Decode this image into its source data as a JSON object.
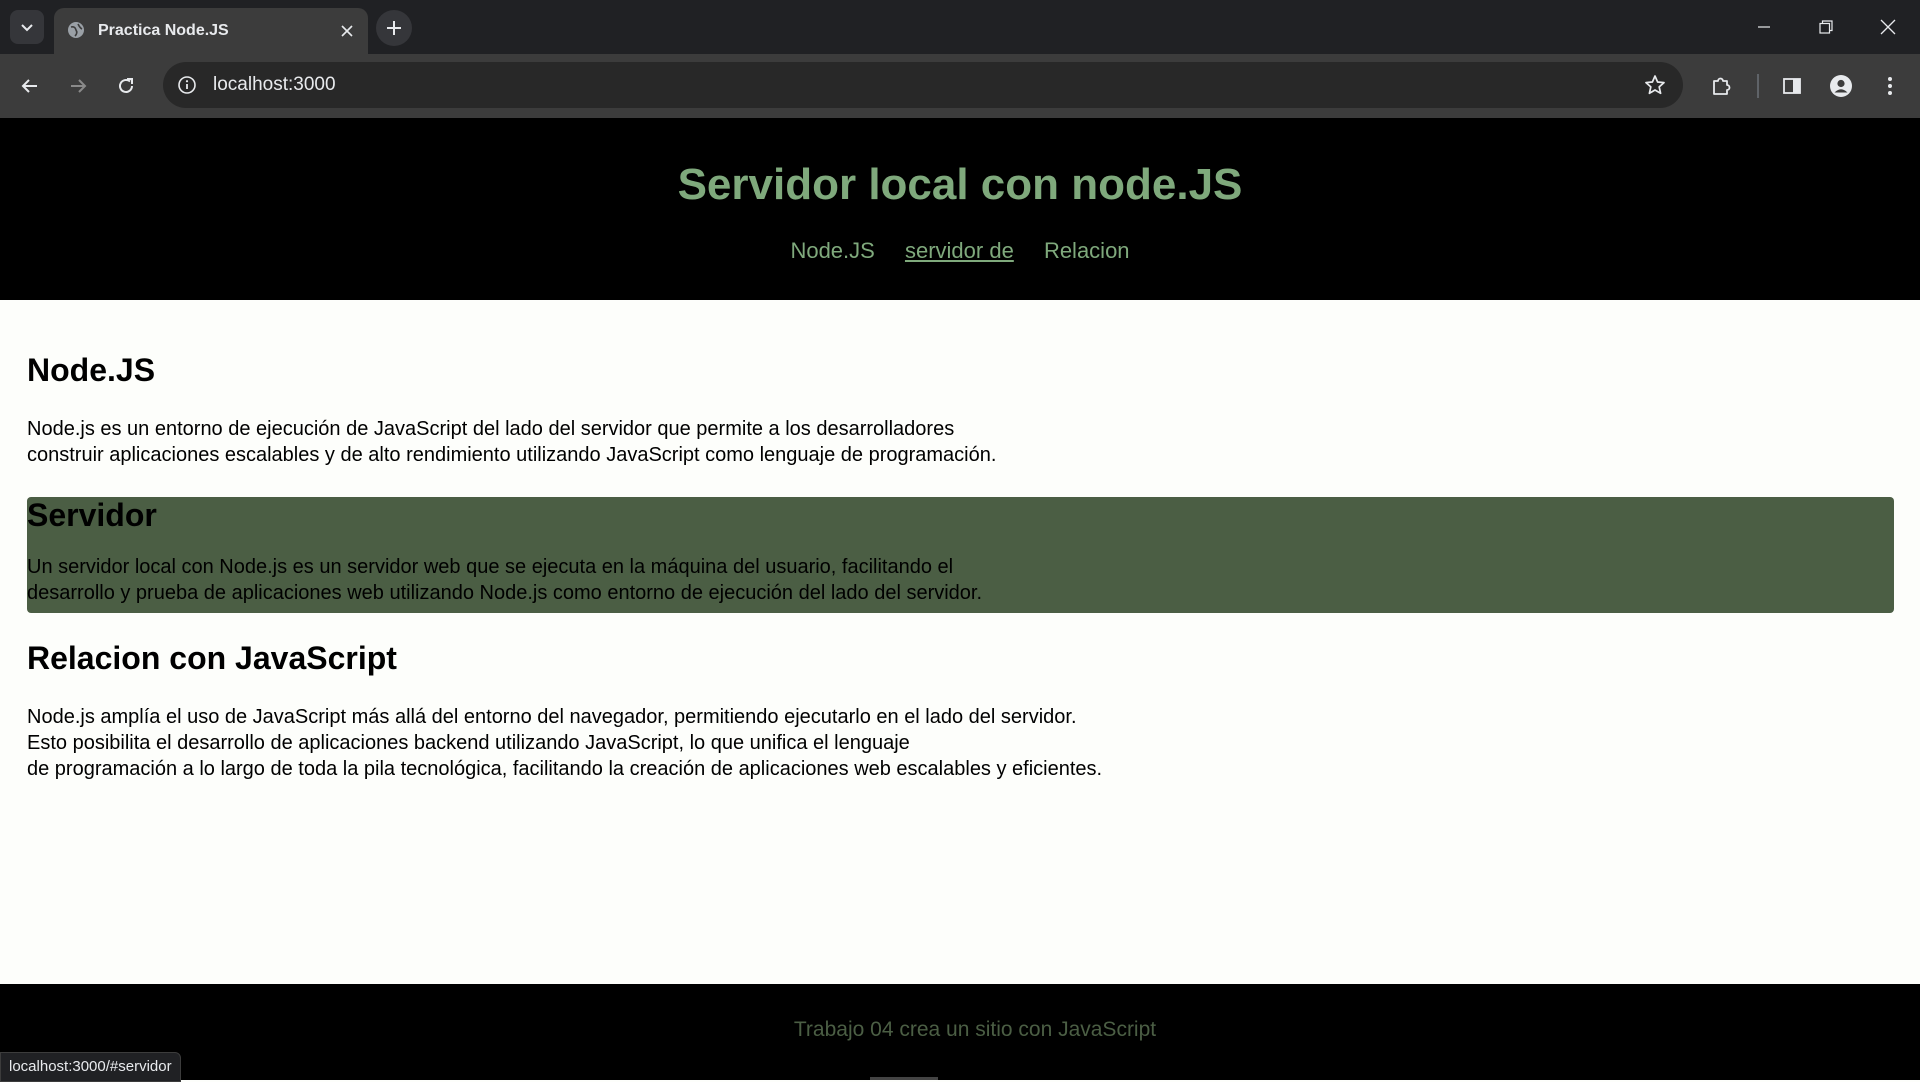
{
  "browser": {
    "tab_title": "Practica Node.JS",
    "url": "localhost:3000",
    "status_url": "localhost:3000/#servidor"
  },
  "site": {
    "title": "Servidor local con node.JS",
    "nav": [
      {
        "label": "Node.JS"
      },
      {
        "label": "servidor de"
      },
      {
        "label": "Relacion"
      }
    ],
    "sections": [
      {
        "heading": "Node.JS",
        "text": "Node.js es un entorno de ejecución de JavaScript del lado del servidor que permite a los desarrolladores\nconstruir aplicaciones escalables y de alto rendimiento utilizando JavaScript como lenguaje de programación."
      },
      {
        "heading": "Servidor",
        "text": "Un servidor local con Node.js es un servidor web que se ejecuta en la máquina del usuario, facilitando el\ndesarrollo y prueba de aplicaciones web utilizando Node.js como entorno de ejecución del lado del servidor."
      },
      {
        "heading": "Relacion con JavaScript",
        "text": "Node.js amplía el uso de JavaScript más allá del entorno del navegador, permitiendo ejecutarlo en el lado del servidor.\nEsto posibilita el desarrollo de aplicaciones backend utilizando JavaScript, lo que unifica el lenguaje\nde programación a lo largo de toda la pila tecnológica, facilitando la creación de aplicaciones web escalables y eficientes."
      }
    ],
    "footer": "Trabajo 04 crea un sitio con JavaScript"
  },
  "colors": {
    "accent": "#7fa97c",
    "highlight_bg": "#4b5e44",
    "header_bg": "#000000",
    "page_bg": "#fdfefb"
  },
  "icons": [
    "tab-list-icon",
    "globe-icon",
    "close-icon",
    "plus-icon",
    "minimize-icon",
    "restore-icon",
    "window-close-icon",
    "back-arrow-icon",
    "forward-arrow-icon",
    "reload-icon",
    "site-info-icon",
    "star-icon",
    "extensions-icon",
    "side-panel-icon",
    "profile-icon",
    "menu-dots-icon"
  ]
}
